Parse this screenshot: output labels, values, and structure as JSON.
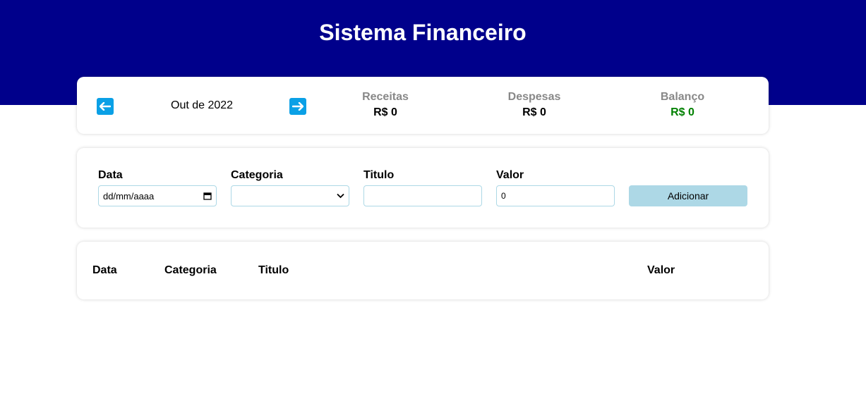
{
  "header": {
    "title": "Sistema Financeiro"
  },
  "info": {
    "month_label": "Out de 2022",
    "prev_icon": "arrow-left-icon",
    "next_icon": "arrow-right-icon",
    "income": {
      "label": "Receitas",
      "value": "R$ 0"
    },
    "expense": {
      "label": "Despesas",
      "value": "R$ 0"
    },
    "balance": {
      "label": "Balanço",
      "value": "R$ 0",
      "color": "#008000"
    }
  },
  "form": {
    "date": {
      "label": "Data",
      "placeholder": "dd/mm/aaaa"
    },
    "category": {
      "label": "Categoria",
      "value": ""
    },
    "title": {
      "label": "Titulo",
      "value": ""
    },
    "amount": {
      "label": "Valor",
      "value": "0"
    },
    "submit_label": "Adicionar"
  },
  "table": {
    "columns": [
      "Data",
      "Categoria",
      "Titulo",
      "Valor"
    ]
  },
  "colors": {
    "header_bg": "#00008b",
    "arrow_btn": "#0aa0e6",
    "add_btn": "#add8e6",
    "muted_label": "#888888"
  }
}
